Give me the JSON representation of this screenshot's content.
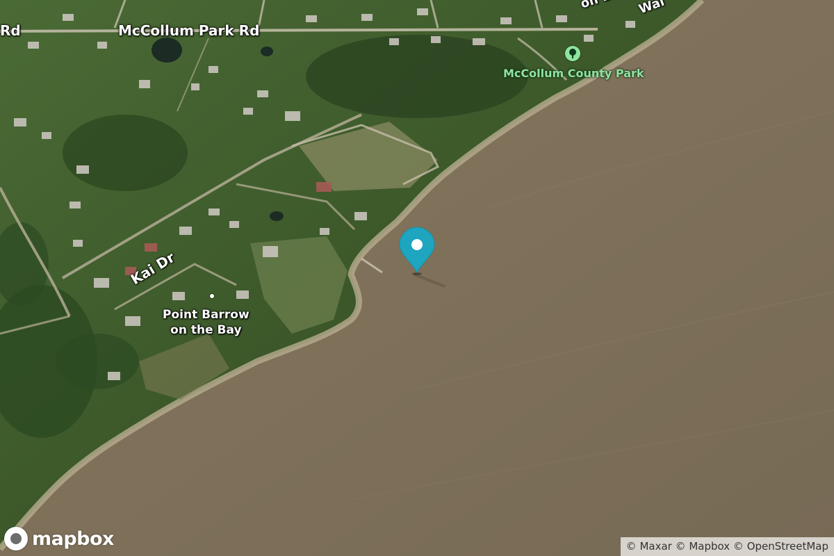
{
  "map": {
    "provider_logo_text": "mapbox",
    "attribution": [
      "© Maxar",
      "© Mapbox",
      "© OpenStreetMap"
    ],
    "road_labels": [
      {
        "id": "rd-left",
        "text": "Rd"
      },
      {
        "id": "mccollum-park-rd",
        "text": "McCollum Park Rd"
      },
      {
        "id": "kai-dr",
        "text": "Kai Dr"
      },
      {
        "id": "lane-top",
        "text": "on Ln"
      },
      {
        "id": "wal-top",
        "text": "Wal"
      }
    ],
    "places": [
      {
        "id": "point-barrow",
        "line1": "Point Barrow",
        "line2": "on the Bay"
      },
      {
        "id": "mccollum-county-park",
        "text": "McCollum County Park",
        "icon": "park-tree-icon"
      }
    ],
    "marker": {
      "icon": "map-pin-icon",
      "color": "#1ea5c0"
    },
    "colors": {
      "water": "#7e7059",
      "land": "#3e5a2c",
      "park_label": "#8fe3a0"
    }
  }
}
